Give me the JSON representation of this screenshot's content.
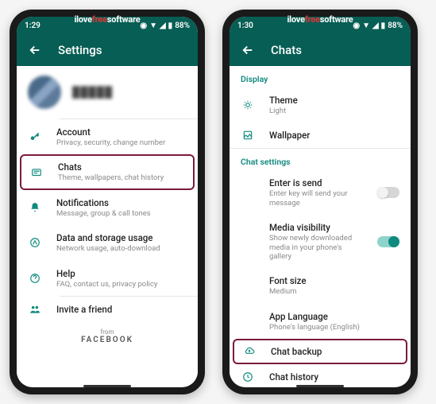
{
  "watermark": {
    "pre": "ilove",
    "mid": "free",
    "post": "software"
  },
  "left": {
    "status": {
      "time": "1:29",
      "battery": "88%"
    },
    "appbar_title": "Settings",
    "profile": {
      "name": "█████"
    },
    "items": [
      {
        "title": "Account",
        "sub": "Privacy, security, change number"
      },
      {
        "title": "Chats",
        "sub": "Theme, wallpapers, chat history"
      },
      {
        "title": "Notifications",
        "sub": "Message, group & call tones"
      },
      {
        "title": "Data and storage usage",
        "sub": "Network usage, auto-download"
      },
      {
        "title": "Help",
        "sub": "FAQ, contact us, privacy policy"
      },
      {
        "title": "Invite a friend",
        "sub": ""
      }
    ],
    "footer": {
      "from": "from",
      "brand": "FACEBOOK"
    }
  },
  "right": {
    "status": {
      "time": "1:30",
      "battery": "88%"
    },
    "appbar_title": "Chats",
    "section_display": "Display",
    "theme": {
      "title": "Theme",
      "sub": "Light"
    },
    "wallpaper": {
      "title": "Wallpaper"
    },
    "section_chat": "Chat settings",
    "enter": {
      "title": "Enter is send",
      "sub": "Enter key will send your message"
    },
    "media": {
      "title": "Media visibility",
      "sub": "Show newly downloaded media in your phone's gallery"
    },
    "font": {
      "title": "Font size",
      "sub": "Medium"
    },
    "lang": {
      "title": "App Language",
      "sub": "Phone's language (English)"
    },
    "backup": {
      "title": "Chat backup"
    },
    "history": {
      "title": "Chat history"
    }
  }
}
